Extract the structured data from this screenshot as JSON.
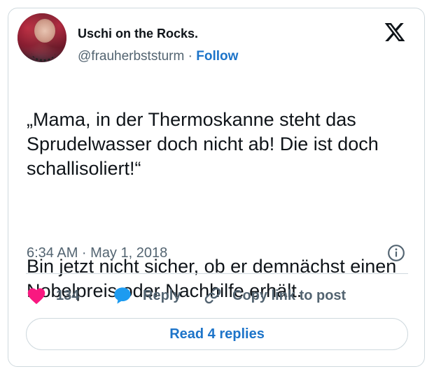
{
  "author": {
    "display_name": "Uschi on the Rocks.",
    "handle": "@frauherbststurm",
    "separator": " · ",
    "follow_label": "Follow"
  },
  "tweet": {
    "paragraph_1": "„Mama, in der Thermoskanne steht das Sprudelwasser doch nicht ab! Die ist doch schallisoliert!“",
    "paragraph_2": "Bin jetzt nicht sicher, ob er demnächst einen Nobelpreis oder Nachhilfe erhält.",
    "timestamp": "6:34 AM · May 1, 2018"
  },
  "actions": {
    "like_count": "134",
    "reply_label": "Reply",
    "copy_link_label": "Copy link to post"
  },
  "read_replies_label": "Read 4 replies",
  "icons": {
    "logo": "x-logo-icon",
    "info": "info-icon",
    "like": "heart-icon",
    "reply": "speech-bubble-icon",
    "copy": "link-icon"
  },
  "colors": {
    "accent_blue": "#1d74c9",
    "like_pink": "#f91880",
    "reply_blue": "#1d9bf0",
    "muted_text": "#536471",
    "border": "#cfd9de"
  }
}
